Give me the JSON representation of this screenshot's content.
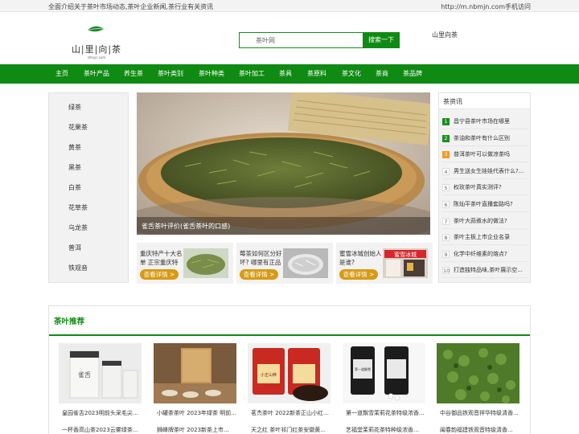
{
  "topbar": {
    "intro": "全面介绍关于茶叶市场动态,茶叶企业新闻,茶行业有关资讯",
    "mobile_link": "http://m.nbmjn.com手机访问"
  },
  "header": {
    "logo_text": "山|里|向|茶",
    "logo_sub": "shlxyc.com",
    "search_placeholder": "茶叶网",
    "search_button": "搜索一下",
    "site_name": "山里向茶"
  },
  "nav": [
    "主页",
    "茶叶产品",
    "养生茶",
    "茶叶类别",
    "茶叶种类",
    "茶叶加工",
    "茶具",
    "茶原料",
    "茶文化",
    "茶商",
    "茶品牌"
  ],
  "categories": [
    "绿茶",
    "花果茶",
    "黄茶",
    "黑茶",
    "白茶",
    "花草茶",
    "乌龙茶",
    "普洱",
    "铁观音"
  ],
  "hero": {
    "caption": "雀舌茶叶评价(雀舌茶叶的口感)"
  },
  "cards": [
    {
      "title": "重庆特产十大名单 正宗重庆特",
      "more": "查看详情 >"
    },
    {
      "title": "莓茶如何区分好坏? 哪里有正品",
      "more": "查看详情 >"
    },
    {
      "title": "蜜雪冰城创始人是谁?",
      "more": "查看详情 >",
      "shop_sign": "蜜雪冰城"
    }
  ],
  "news": {
    "heading": "茶资讯",
    "items": [
      {
        "num": "1",
        "text": "昌宁县茶叶市场在哪里",
        "style": "g"
      },
      {
        "num": "2",
        "text": "茶油和茶叶有什么区别",
        "style": "g"
      },
      {
        "num": "3",
        "text": "普洱茶叶可以做凉茶吗",
        "style": "o"
      },
      {
        "num": "4",
        "text": "男生送女生娃娃代表什么?...",
        "style": "n"
      },
      {
        "num": "5",
        "text": "权玫茶叶真实测评?",
        "style": "n"
      },
      {
        "num": "6",
        "text": "陈灿平茶叶直播套路吗?",
        "style": "n"
      },
      {
        "num": "7",
        "text": "茶叶大蒜煮水的做法?",
        "style": "n"
      },
      {
        "num": "8",
        "text": "茶叶主板上市企业名录",
        "style": "n"
      },
      {
        "num": "9",
        "text": "化学中纤维素的熔点?",
        "style": "n"
      },
      {
        "num": "10",
        "text": "打造独特品味,茶叶展示空...",
        "style": "n"
      }
    ]
  },
  "recommend": {
    "title": "茶叶推荐",
    "products": [
      {
        "name": "皇园雀舌2023明前头采毛尖云...",
        "name2": "一杯香高山茶2023云雾绿茶...",
        "box_text": "雀舌"
      },
      {
        "name": "小罐茶茶叶 2023年绿茶 明前...",
        "name2": "狮峰牌茶叶 2023新茶上市..."
      },
      {
        "name": "茗杰茶叶 2022新茶正山小红茶...",
        "name2": "天之红 茶叶祁门红茶安徽黄...",
        "can_text": "小正山种"
      },
      {
        "name": "第一道飘雪茉莉花茶特级浓香...",
        "name2": "艺福堂茉莉花茶特种级浓香...",
        "can_text": "第一道飘雪"
      },
      {
        "name": "中谷御品铁观音祥华特级清香...",
        "name2": "闽春韵福建铁观音特级清香..."
      }
    ]
  },
  "colors": {
    "brand_green": "#0f8a12",
    "badge_orange": "#f09a21",
    "button_gold": "#d79b12"
  }
}
